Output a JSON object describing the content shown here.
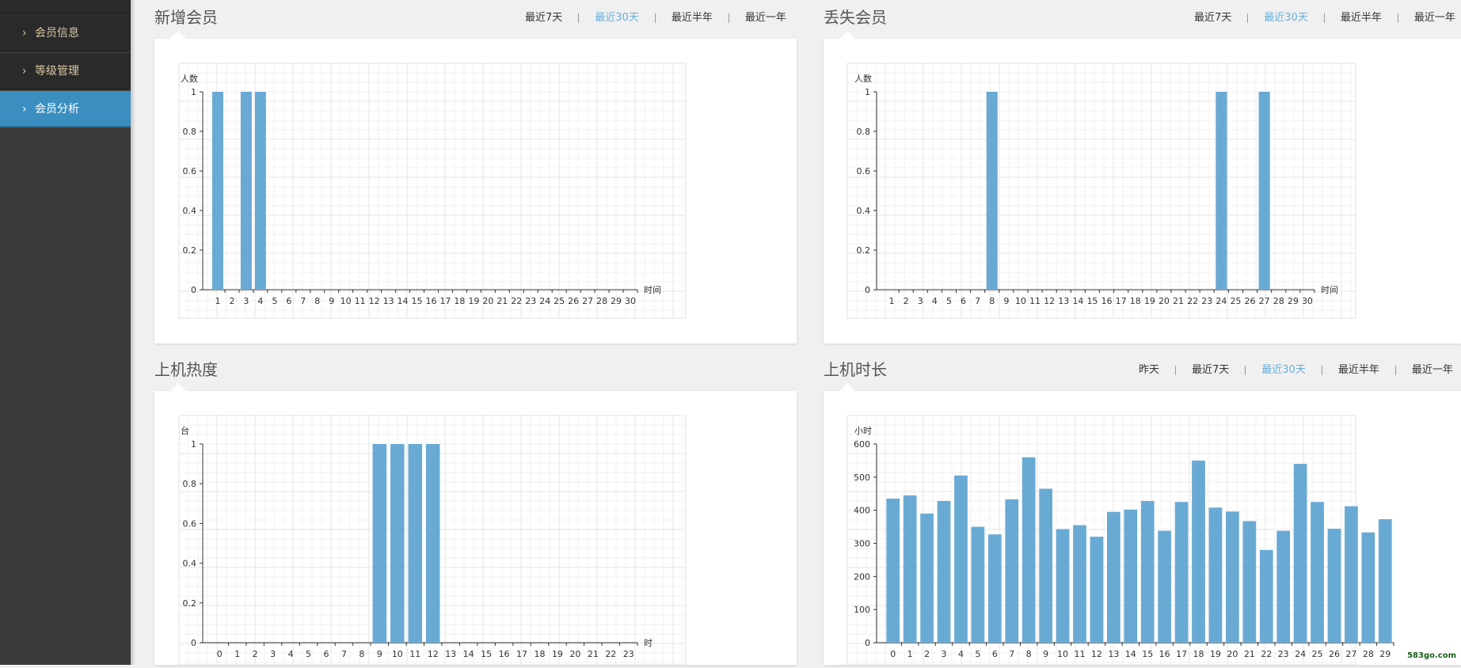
{
  "sidebar": {
    "items": [
      {
        "label": "会员信息",
        "active": false
      },
      {
        "label": "等级管理",
        "active": false
      },
      {
        "label": "会员分析",
        "active": true
      }
    ]
  },
  "sections": {
    "new_members": {
      "title": "新增会员",
      "filters": [
        {
          "label": "最近7天",
          "active": false
        },
        {
          "label": "最近30天",
          "active": true
        },
        {
          "label": "最近半年",
          "active": false
        },
        {
          "label": "最近一年",
          "active": false
        }
      ]
    },
    "lost_members": {
      "title": "丢失会员",
      "filters": [
        {
          "label": "最近7天",
          "active": false
        },
        {
          "label": "最近30天",
          "active": true
        },
        {
          "label": "最近半年",
          "active": false
        },
        {
          "label": "最近一年",
          "active": false
        }
      ]
    },
    "usage_heat": {
      "title": "上机热度",
      "filters": []
    },
    "usage_duration": {
      "title": "上机时长",
      "filters": [
        {
          "label": "昨天",
          "active": false
        },
        {
          "label": "最近7天",
          "active": false
        },
        {
          "label": "最近30天",
          "active": true
        },
        {
          "label": "最近半年",
          "active": false
        },
        {
          "label": "最近一年",
          "active": false
        }
      ]
    }
  },
  "watermark": "583go.com",
  "colors": {
    "bar": "#69aad4",
    "active_filter": "#6aaed8",
    "sidebar_active": "#3b8fc0"
  },
  "chart_data": [
    {
      "id": "new_members",
      "type": "bar",
      "ylabel": "人数",
      "xlabel": "时间",
      "ylim": [
        0,
        1
      ],
      "yticks": [
        0,
        0.2,
        0.4,
        0.6,
        0.8,
        1
      ],
      "categories": [
        "1",
        "2",
        "3",
        "4",
        "5",
        "6",
        "7",
        "8",
        "9",
        "10",
        "11",
        "12",
        "13",
        "14",
        "15",
        "16",
        "17",
        "18",
        "19",
        "20",
        "21",
        "22",
        "23",
        "24",
        "25",
        "26",
        "27",
        "28",
        "29",
        "30"
      ],
      "values": [
        1,
        0,
        1,
        1,
        0,
        0,
        0,
        0,
        0,
        0,
        0,
        0,
        0,
        0,
        0,
        0,
        0,
        0,
        0,
        0,
        0,
        0,
        0,
        0,
        0,
        0,
        0,
        0,
        0,
        0
      ],
      "grid": true
    },
    {
      "id": "lost_members",
      "type": "bar",
      "ylabel": "人数",
      "xlabel": "时间",
      "ylim": [
        0,
        1
      ],
      "yticks": [
        0,
        0.2,
        0.4,
        0.6,
        0.8,
        1
      ],
      "categories": [
        "1",
        "2",
        "3",
        "4",
        "5",
        "6",
        "7",
        "8",
        "9",
        "10",
        "11",
        "12",
        "13",
        "14",
        "15",
        "16",
        "17",
        "18",
        "19",
        "20",
        "21",
        "22",
        "23",
        "24",
        "25",
        "26",
        "27",
        "28",
        "29",
        "30"
      ],
      "values": [
        0,
        0,
        0,
        0,
        0,
        0,
        0,
        1,
        0,
        0,
        0,
        0,
        0,
        0,
        0,
        0,
        0,
        0,
        0,
        0,
        0,
        0,
        0,
        1,
        0,
        0,
        1,
        0,
        0,
        0
      ],
      "grid": true
    },
    {
      "id": "usage_heat",
      "type": "bar",
      "ylabel": "台",
      "xlabel": "时",
      "ylim": [
        0,
        1
      ],
      "yticks": [
        0,
        0.2,
        0.4,
        0.6,
        0.8,
        1
      ],
      "categories": [
        "0",
        "1",
        "2",
        "3",
        "4",
        "5",
        "6",
        "7",
        "8",
        "9",
        "10",
        "11",
        "12",
        "13",
        "14",
        "15",
        "16",
        "17",
        "18",
        "19",
        "20",
        "21",
        "22",
        "23"
      ],
      "values": [
        0,
        0,
        0,
        0,
        0,
        0,
        0,
        0,
        0,
        1,
        1,
        1,
        1,
        0,
        0,
        0,
        0,
        0,
        0,
        0,
        0,
        0,
        0,
        0
      ],
      "grid": true
    },
    {
      "id": "usage_duration",
      "type": "bar",
      "ylabel": "小时",
      "xlabel": "",
      "ylim": [
        0,
        600
      ],
      "yticks": [
        0,
        100,
        200,
        300,
        400,
        500,
        600
      ],
      "categories": [
        "0",
        "1",
        "2",
        "3",
        "4",
        "5",
        "6",
        "7",
        "8",
        "9",
        "10",
        "11",
        "12",
        "13",
        "14",
        "15",
        "16",
        "17",
        "18",
        "19",
        "20",
        "21",
        "22",
        "23",
        "24",
        "25",
        "26",
        "27",
        "28",
        "29"
      ],
      "values": [
        435,
        445,
        390,
        428,
        505,
        350,
        327,
        433,
        560,
        465,
        343,
        355,
        320,
        395,
        402,
        428,
        338,
        425,
        550,
        408,
        396,
        367,
        280,
        338,
        540,
        425,
        344,
        412,
        333,
        373
      ],
      "grid": true
    }
  ]
}
